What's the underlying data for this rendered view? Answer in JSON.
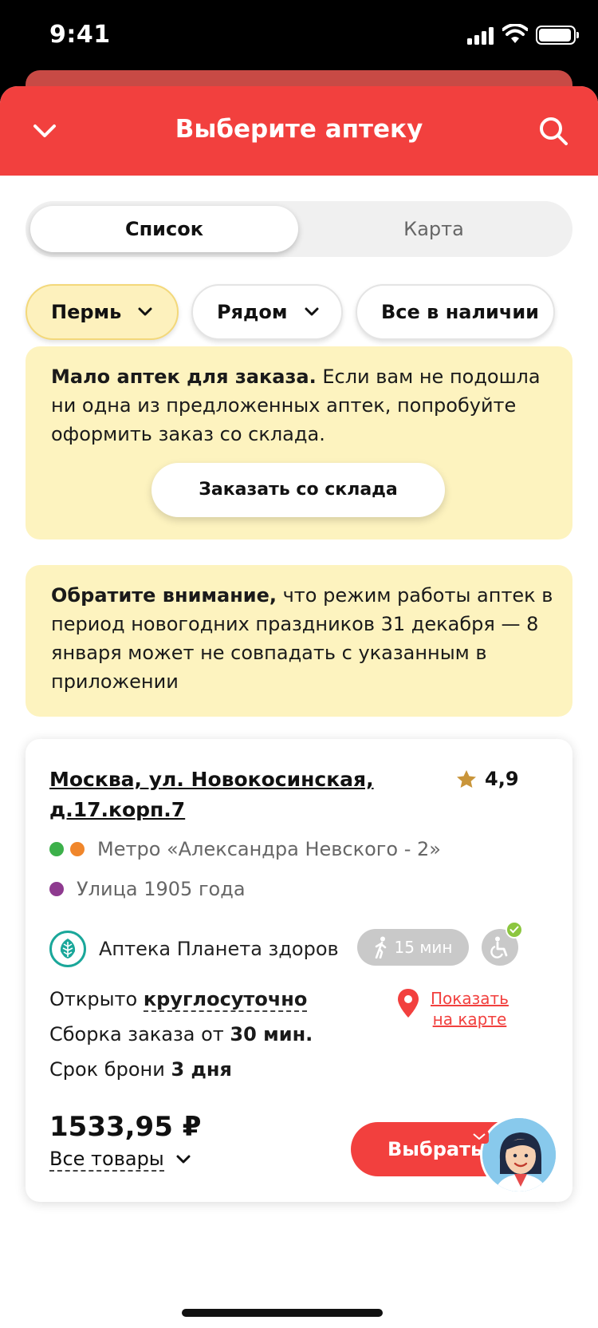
{
  "status_bar": {
    "time": "9:41"
  },
  "header": {
    "title": "Выберите аптеку"
  },
  "segment": {
    "list_label": "Список",
    "map_label": "Карта"
  },
  "filters": {
    "city": "Пермь",
    "nearby": "Рядом",
    "stock": "Все в наличии"
  },
  "notice_low": {
    "title": "Мало аптек для заказа.",
    "text": " Если вам не подошла ни одна из предложенных аптек, попробуйте оформить заказ со склада.",
    "button": "Заказать со склада"
  },
  "notice_holiday": {
    "title": "Обратите внимание,",
    "text": " что режим работы аптек в период новогодних праздников 31 декабря — 8 января может не совпадать с указанным в приложении"
  },
  "pharmacy": {
    "address": "Москва, ул. Новокосинская, д.17.корп.7",
    "rating": "4,9",
    "metro1": "Метро «Александра Невского - 2»",
    "metro2": "Улица 1905 года",
    "metro_colors": [
      "#3cb04a",
      "#f0862b",
      "#8e3a8f"
    ],
    "brand": "Аптека Планета здоровья",
    "walk_time": "15 мин",
    "open_prefix": "Открыто ",
    "open_value": "круглосуточно",
    "assembly_prefix": "Сборка заказа от ",
    "assembly_value": "30 мин.",
    "reserve_prefix": "Срок брони ",
    "reserve_value": "3 дня",
    "map_link_line1": "Показать",
    "map_link_line2": "на карте",
    "price": "1533,95 ₽",
    "all_goods": "Все товары",
    "choose_button": "Выбрать"
  },
  "colors": {
    "accent": "#f2403e",
    "note_bg": "#fdf3bf",
    "chip_selected": "#fdf1bd"
  },
  "icons": [
    "chevron-down-icon",
    "search-icon",
    "star-icon",
    "pharmacy-logo-icon",
    "walk-icon",
    "wheelchair-icon",
    "map-pin-icon",
    "assistant-avatar-icon"
  ]
}
